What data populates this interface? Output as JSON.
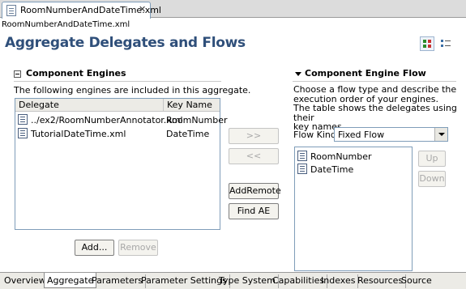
{
  "editor_tab": {
    "title": "RoomNumberAndDateTime.xml",
    "close": "✕"
  },
  "breadcrumb": "RoomNumberAndDateTime.xml",
  "page_title": "Aggregate Delegates and Flows",
  "left": {
    "header": "Component Engines",
    "description": "The following engines are included in this aggregate.",
    "columns": [
      "Delegate",
      "Key Name"
    ],
    "rows": [
      {
        "delegate": "../ex2/RoomNumberAnnotator.xml",
        "key": "RoomNumber"
      },
      {
        "delegate": "TutorialDateTime.xml",
        "key": "DateTime"
      }
    ],
    "add_label": "Add...",
    "remove_label": "Remove"
  },
  "middle": {
    "move_right": ">>",
    "move_left": "<<",
    "add_remote": "AddRemote",
    "find_ae": "Find AE"
  },
  "right": {
    "header": "Component Engine Flow",
    "description_lines": [
      "Choose a flow type and describe the",
      "execution order of your engines.",
      "The table shows the delegates using their",
      "key names."
    ],
    "flow_kind_label": "Flow Kind:",
    "flow_kind_value": "Fixed Flow",
    "items": [
      "RoomNumber",
      "DateTime"
    ],
    "up_label": "Up",
    "down_label": "Down"
  },
  "bottom_tabs": [
    "Overview",
    "Aggregate",
    "Parameters",
    "Parameter Settings",
    "Type System",
    "Capabilities",
    "Indexes",
    "Resources",
    "Source"
  ],
  "active_tab": "Aggregate",
  "colors": {
    "title": "#2f4f7a",
    "border": "#7f9db9"
  }
}
